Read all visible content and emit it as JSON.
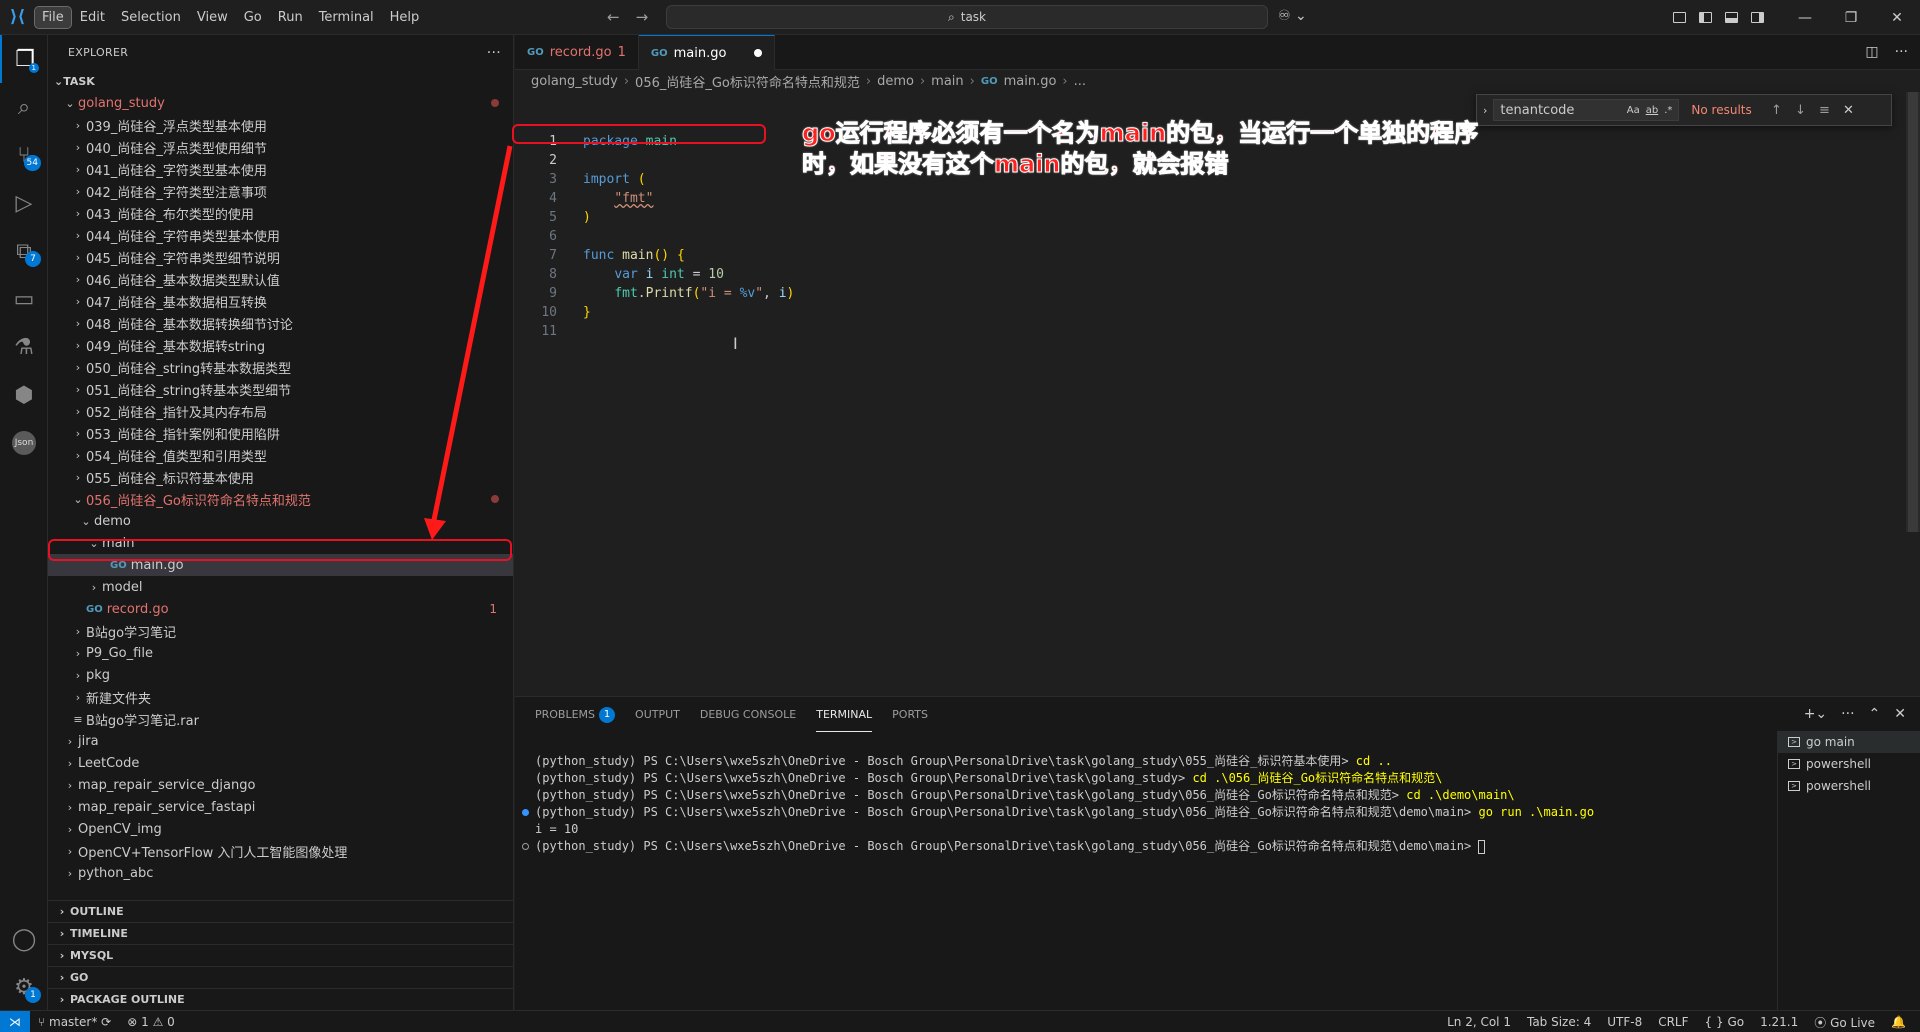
{
  "menu": {
    "items": [
      "File",
      "Edit",
      "Selection",
      "View",
      "Go",
      "Run",
      "Terminal",
      "Help"
    ],
    "search_text": "task"
  },
  "activity_badges": {
    "source_control": "54",
    "extensions": "7",
    "accounts": "1"
  },
  "explorer": {
    "header": "EXPLORER",
    "section": "TASK",
    "root_folder": "golang_study",
    "tree": [
      {
        "label": "039_尚硅谷_浮点类型基本使用",
        "indent": 1
      },
      {
        "label": "040_尚硅谷_浮点类型使用细节",
        "indent": 1
      },
      {
        "label": "041_尚硅谷_字符类型基本使用",
        "indent": 1
      },
      {
        "label": "042_尚硅谷_字符类型注意事项",
        "indent": 1
      },
      {
        "label": "043_尚硅谷_布尔类型的使用",
        "indent": 1
      },
      {
        "label": "044_尚硅谷_字符串类型基本使用",
        "indent": 1
      },
      {
        "label": "045_尚硅谷_字符串类型细节说明",
        "indent": 1
      },
      {
        "label": "046_尚硅谷_基本数据类型默认值",
        "indent": 1
      },
      {
        "label": "047_尚硅谷_基本数据相互转换",
        "indent": 1
      },
      {
        "label": "048_尚硅谷_基本数据转换细节讨论",
        "indent": 1
      },
      {
        "label": "049_尚硅谷_基本数据转string",
        "indent": 1
      },
      {
        "label": "050_尚硅谷_string转基本数据类型",
        "indent": 1
      },
      {
        "label": "051_尚硅谷_string转基本类型细节",
        "indent": 1
      },
      {
        "label": "052_尚硅谷_指针及其内存布局",
        "indent": 1
      },
      {
        "label": "053_尚硅谷_指针案例和使用陷阱",
        "indent": 1
      },
      {
        "label": "054_尚硅谷_值类型和引用类型",
        "indent": 1
      },
      {
        "label": "055_尚硅谷_标识符基本使用",
        "indent": 1
      }
    ],
    "open_folder": "056_尚硅谷_Go标识符命名特点和规范",
    "demo_folder": "demo",
    "main_folder": "main",
    "main_file": "main.go",
    "model_folder": "model",
    "record_file": "record.go",
    "record_errors": "1",
    "tree_after": [
      {
        "label": "B站go学习笔记",
        "indent": 1,
        "kind": "folder"
      },
      {
        "label": "P9_Go_file",
        "indent": 1,
        "kind": "folder"
      },
      {
        "label": "pkg",
        "indent": 1,
        "kind": "folder"
      },
      {
        "label": "新建文件夹",
        "indent": 1,
        "kind": "folder"
      },
      {
        "label": "B站go学习笔记.rar",
        "indent": 1,
        "kind": "file"
      },
      {
        "label": "jira",
        "indent": 0,
        "kind": "folder"
      },
      {
        "label": "LeetCode",
        "indent": 0,
        "kind": "folder"
      },
      {
        "label": "map_repair_service_django",
        "indent": 0,
        "kind": "folder"
      },
      {
        "label": "map_repair_service_fastapi",
        "indent": 0,
        "kind": "folder"
      },
      {
        "label": "OpenCV_img",
        "indent": 0,
        "kind": "folder"
      },
      {
        "label": "OpenCV+TensorFlow 入门人工智能图像处理",
        "indent": 0,
        "kind": "folder"
      },
      {
        "label": "python_abc",
        "indent": 0,
        "kind": "folder"
      }
    ],
    "bottom_sections": [
      "OUTLINE",
      "TIMELINE",
      "MYSQL",
      "GO",
      "PACKAGE OUTLINE"
    ]
  },
  "tabs": [
    {
      "label": "record.go",
      "suffix": "1"
    },
    {
      "label": "main.go",
      "suffix": ""
    }
  ],
  "breadcrumb": [
    "golang_study",
    "056_尚硅谷_Go标识符命名特点和规范",
    "demo",
    "main",
    "main.go",
    "..."
  ],
  "find": {
    "value": "tenantcode",
    "opt_case": "Aa",
    "opt_word": "ab",
    "opt_regex": ".*",
    "status": "No results"
  },
  "line_numbers": [
    "1",
    "2",
    "3",
    "4",
    "5",
    "6",
    "7",
    "8",
    "9",
    "10",
    "11"
  ],
  "annotation": "go运行程序必须有一个名为main的包，当运行一个单独的程序时，如果没有这个main的包，就会报错",
  "panel": {
    "tabs": [
      "PROBLEMS",
      "OUTPUT",
      "DEBUG CONSOLE",
      "TERMINAL",
      "PORTS"
    ],
    "problems_count": "1",
    "terminal_lines": [
      {
        "prefix": "(python_study) PS C:\\Users\\wxe5szh\\OneDrive - Bosch Group\\PersonalDrive\\task\\golang_study\\055_尚硅谷_标识符基本使用> ",
        "cmd": "cd .."
      },
      {
        "prefix": "(python_study) PS C:\\Users\\wxe5szh\\OneDrive - Bosch Group\\PersonalDrive\\task\\golang_study> ",
        "cmd": "cd .\\056_尚硅谷_Go标识符命名特点和规范\\"
      },
      {
        "prefix": "(python_study) PS C:\\Users\\wxe5szh\\OneDrive - Bosch Group\\PersonalDrive\\task\\golang_study\\056_尚硅谷_Go标识符命名特点和规范> ",
        "cmd": "cd .\\demo\\main\\"
      },
      {
        "prefix": "(python_study) PS C:\\Users\\wxe5szh\\OneDrive - Bosch Group\\PersonalDrive\\task\\golang_study\\056_尚硅谷_Go标识符命名特点和规范\\demo\\main> ",
        "cmd": "go run .\\main.go"
      },
      {
        "prefix": "i = 10",
        "cmd": ""
      },
      {
        "prefix": "(python_study) PS C:\\Users\\wxe5szh\\OneDrive - Bosch Group\\PersonalDrive\\task\\golang_study\\056_尚硅谷_Go标识符命名特点和规范\\demo\\main> ",
        "cmd": ""
      }
    ],
    "terminals": [
      "go  main",
      "powershell",
      "powershell"
    ]
  },
  "status": {
    "branch": "master*",
    "errors": "1",
    "warnings": "0",
    "position": "Ln 2, Col 1",
    "tab_size": "Tab Size: 4",
    "encoding": "UTF-8",
    "eol": "CRLF",
    "language": "Go",
    "go_version": "1.21.1",
    "go_live": "Go Live"
  },
  "colors": {
    "accent": "#0078d4",
    "annotation": "#ff2020",
    "error": "#e2736e"
  }
}
